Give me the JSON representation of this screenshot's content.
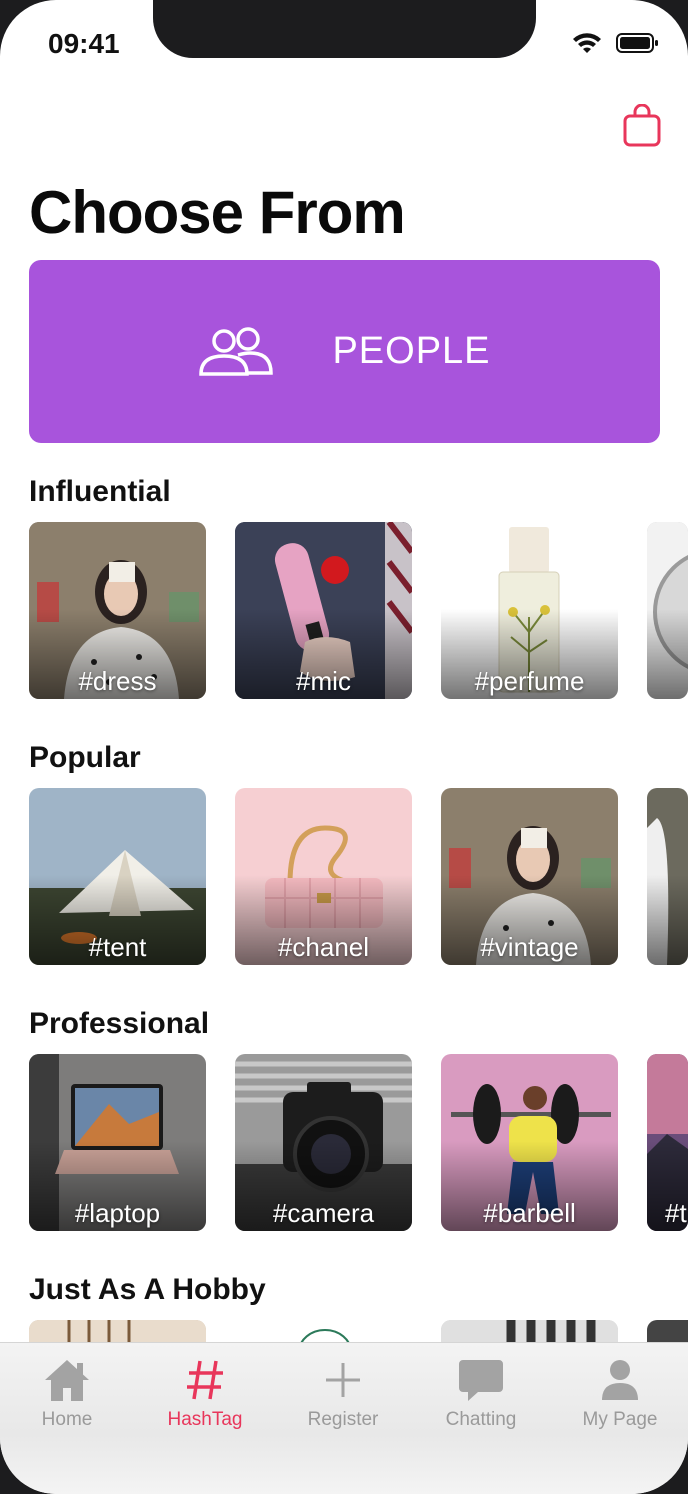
{
  "status": {
    "time": "09:41"
  },
  "header": {
    "title": "Choose From"
  },
  "banner": {
    "label": "PEOPLE",
    "color": "#a854dc"
  },
  "sections": [
    {
      "title": "Influential",
      "tags": [
        "#dress",
        "#mic",
        "#perfume"
      ]
    },
    {
      "title": "Popular",
      "tags": [
        "#tent",
        "#chanel",
        "#vintage"
      ]
    },
    {
      "title": "Professional",
      "tags": [
        "#laptop",
        "#camera",
        "#barbell",
        "#t"
      ]
    },
    {
      "title": "Just As A Hobby",
      "tags": []
    }
  ],
  "tabs": [
    {
      "label": "Home",
      "icon": "home-icon"
    },
    {
      "label": "HashTag",
      "icon": "hashtag-icon",
      "active": true
    },
    {
      "label": "Register",
      "icon": "plus-icon"
    },
    {
      "label": "Chatting",
      "icon": "chat-icon"
    },
    {
      "label": "My Page",
      "icon": "person-icon"
    }
  ],
  "colors": {
    "accent": "#e8365b",
    "inactive": "#9a9a9a"
  }
}
